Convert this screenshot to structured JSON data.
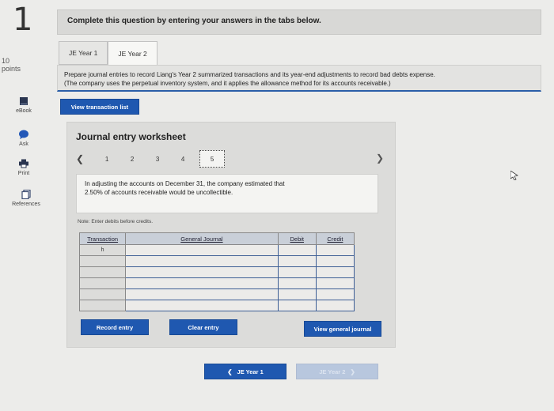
{
  "question": {
    "number": "1",
    "points_value": "10",
    "points_label": "points"
  },
  "sidebar": {
    "items": [
      {
        "label": "eBook"
      },
      {
        "label": "Ask"
      },
      {
        "label": "Print"
      },
      {
        "label": "References"
      }
    ]
  },
  "banner": {
    "text": "Complete this question by entering your answers in the tabs below."
  },
  "tabs": [
    {
      "label": "JE Year 1",
      "active": false
    },
    {
      "label": "JE Year 2",
      "active": true
    }
  ],
  "instructions": {
    "line1": "Prepare journal entries to record Liang's Year 2 summarized transactions and its year-end adjustments to record bad debts expense.",
    "line2": "(The company uses the perpetual inventory system, and it applies the allowance method for its accounts receivable.)"
  },
  "view_transaction_list": "View transaction list",
  "worksheet": {
    "title": "Journal entry worksheet",
    "pages": [
      "1",
      "2",
      "3",
      "4",
      "5"
    ],
    "current_page": "5",
    "description_line1": "In adjusting the accounts on December 31, the company estimated that",
    "description_line2": "2.50% of accounts receivable would be uncollectible.",
    "note": "Note: Enter debits before credits.",
    "table": {
      "headers": {
        "transaction": "Transaction",
        "general_journal": "General Journal",
        "debit": "Debit",
        "credit": "Credit"
      },
      "first_transaction": "h"
    },
    "record_entry": "Record entry",
    "clear_entry": "Clear entry",
    "view_general_journal": "View general journal"
  },
  "nav": {
    "prev_label": "JE Year 1",
    "next_label": "JE Year 2"
  },
  "colors": {
    "accent": "#1f58b0",
    "header_blue": "#c9cfd8",
    "next_disabled": "#b8c7de"
  }
}
